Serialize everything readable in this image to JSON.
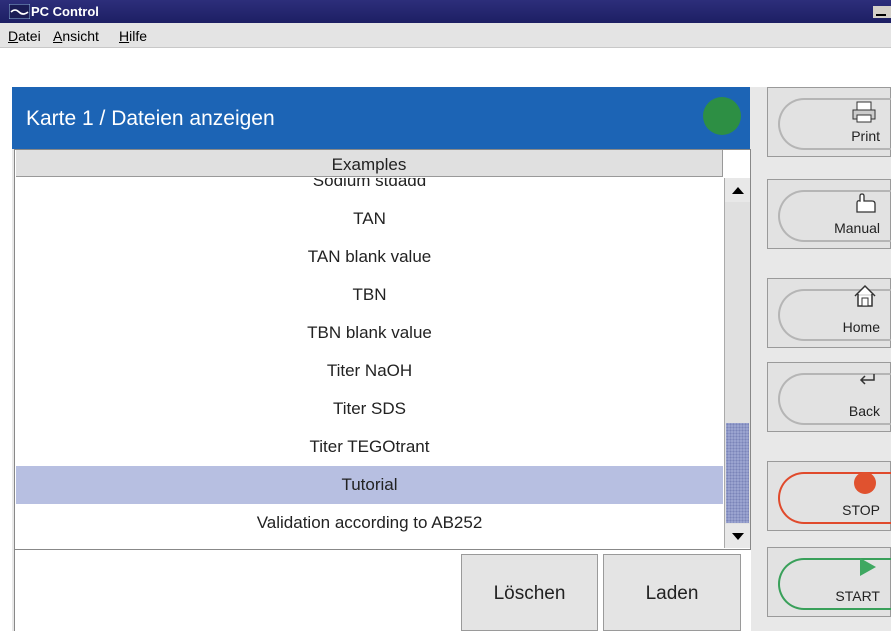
{
  "window": {
    "title": "PC Control",
    "app_icon": "wave-icon",
    "minimize_icon": "minimize-icon"
  },
  "menu": {
    "items": [
      {
        "label": "Datei",
        "mnemonic": "D",
        "rest": "atei"
      },
      {
        "label": "Ansicht",
        "mnemonic": "A",
        "rest": "nsicht"
      },
      {
        "label": "Hilfe",
        "mnemonic": "H",
        "rest": "ilfe"
      }
    ]
  },
  "header": {
    "title": "Karte 1 / Dateien anzeigen",
    "status_color": "#2d8f44"
  },
  "list": {
    "column_header": "Examples",
    "items": [
      "Sodium stdadd",
      "TAN",
      "TAN blank value",
      "TBN",
      "TBN blank value",
      "Titer NaOH",
      "Titer SDS",
      "Titer TEGOtrant",
      "Tutorial",
      "Validation according to AB252"
    ],
    "selected": "Tutorial",
    "selected_color": "#b7bfe1"
  },
  "buttons": {
    "delete_label": "Löschen",
    "load_label": "Laden"
  },
  "sidebar": {
    "print_label": "Print",
    "manual_label": "Manual",
    "home_label": "Home",
    "back_label": "Back",
    "stop_label": "STOP",
    "start_label": "START",
    "print_icon": "printer-icon",
    "manual_icon": "hand-icon",
    "home_icon": "home-icon",
    "back_icon": "back-arrow-icon",
    "stop_icon": "stop-icon",
    "start_icon": "play-icon",
    "stop_color": "#e0522f",
    "start_color": "#3fa861"
  }
}
